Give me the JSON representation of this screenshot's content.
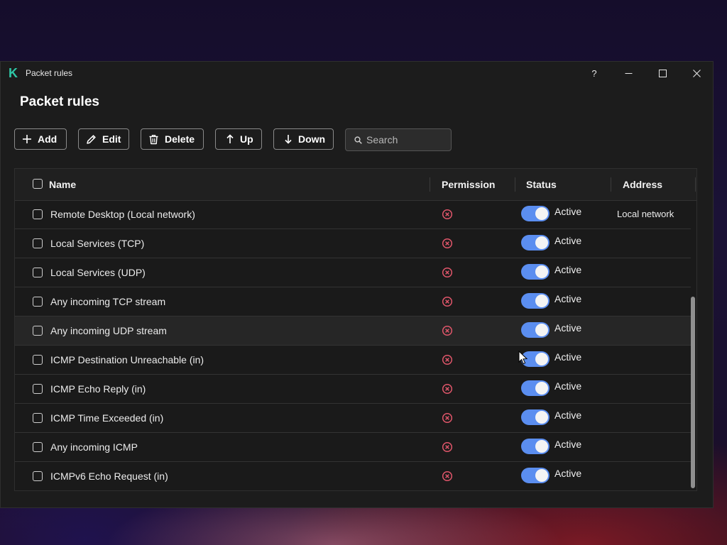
{
  "window": {
    "title": "Packet rules",
    "app_logo": "K",
    "help_label": "?",
    "icons": {
      "minimize": "minimize-icon",
      "maximize": "maximize-icon",
      "close": "close-icon"
    }
  },
  "page": {
    "title": "Packet rules"
  },
  "toolbar": {
    "add_label": "Add",
    "edit_label": "Edit",
    "delete_label": "Delete",
    "up_label": "Up",
    "down_label": "Down",
    "search_placeholder": "Search"
  },
  "table": {
    "columns": {
      "name": "Name",
      "permission": "Permission",
      "status": "Status",
      "address": "Address"
    },
    "rows": [
      {
        "name": "Remote Desktop (Local network)",
        "permission": "blocked",
        "status": "Active",
        "enabled": true,
        "address": "Local network"
      },
      {
        "name": "Local Services (TCP)",
        "permission": "blocked",
        "status": "Active",
        "enabled": true,
        "address": ""
      },
      {
        "name": "Local Services (UDP)",
        "permission": "blocked",
        "status": "Active",
        "enabled": true,
        "address": ""
      },
      {
        "name": "Any incoming TCP stream",
        "permission": "blocked",
        "status": "Active",
        "enabled": true,
        "address": ""
      },
      {
        "name": "Any incoming UDP stream",
        "permission": "blocked",
        "status": "Active",
        "enabled": true,
        "address": ""
      },
      {
        "name": "ICMP Destination Unreachable (in)",
        "permission": "blocked",
        "status": "Active",
        "enabled": true,
        "address": ""
      },
      {
        "name": "ICMP Echo Reply (in)",
        "permission": "blocked",
        "status": "Active",
        "enabled": true,
        "address": ""
      },
      {
        "name": "ICMP Time Exceeded (in)",
        "permission": "blocked",
        "status": "Active",
        "enabled": true,
        "address": ""
      },
      {
        "name": "Any incoming ICMP",
        "permission": "blocked",
        "status": "Active",
        "enabled": true,
        "address": ""
      },
      {
        "name": "ICMPv6 Echo Request (in)",
        "permission": "blocked",
        "status": "Active",
        "enabled": true,
        "address": ""
      }
    ]
  },
  "colors": {
    "accent_toggle": "#5b8ef0",
    "block_icon": "#e0566a",
    "logo": "#2fc7a6",
    "window_bg": "#1c1c1c"
  }
}
